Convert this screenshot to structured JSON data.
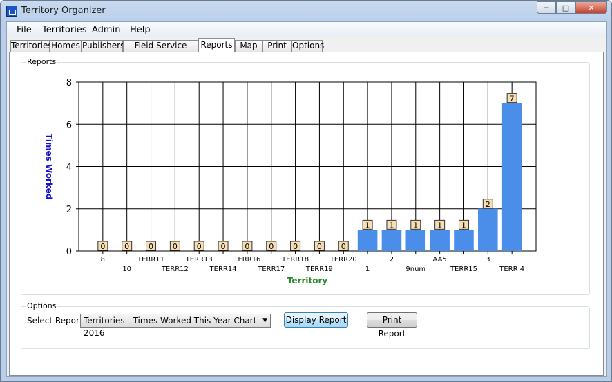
{
  "window": {
    "title": "Territory Organizer",
    "minimize": "─",
    "maximize": "□",
    "close": "✕"
  },
  "menu": [
    "File",
    "Territories",
    "Admin",
    "Help"
  ],
  "tabs": [
    "Territories",
    "Homes",
    "Publishers",
    "Field Service Groups",
    "Reports",
    "Map",
    "Print",
    "Options"
  ],
  "active_tab": "Reports",
  "reports_group": {
    "title": "Reports"
  },
  "options_group": {
    "title": "Options"
  },
  "select_report": {
    "label": "Select Report:",
    "value": "Territories - Times Worked This Year Chart - 2016"
  },
  "buttons": {
    "display": "Display Report",
    "print": "Print Report"
  },
  "colors": {
    "bar": "#4a8eea",
    "ylabel": "#1212d0",
    "xlabel": "#2a8a2a",
    "label_bg": "#f5deb3"
  },
  "chart_data": {
    "type": "bar",
    "categories": [
      "8",
      "10",
      "TERR11",
      "TERR12",
      "TERR13",
      "TERR14",
      "TERR16",
      "TERR17",
      "TERR18",
      "TERR19",
      "TERR20",
      "1",
      "2",
      "9num",
      "AA5",
      "TERR15",
      "3",
      "TERR 4"
    ],
    "values": [
      0,
      0,
      0,
      0,
      0,
      0,
      0,
      0,
      0,
      0,
      0,
      1,
      1,
      1,
      1,
      1,
      2,
      7
    ],
    "xlabel": "Territory",
    "ylabel": "Times Worked",
    "ylim": [
      0,
      8
    ],
    "yticks": [
      0,
      2,
      4,
      6,
      8
    ],
    "grid": true,
    "data_labels": true
  }
}
